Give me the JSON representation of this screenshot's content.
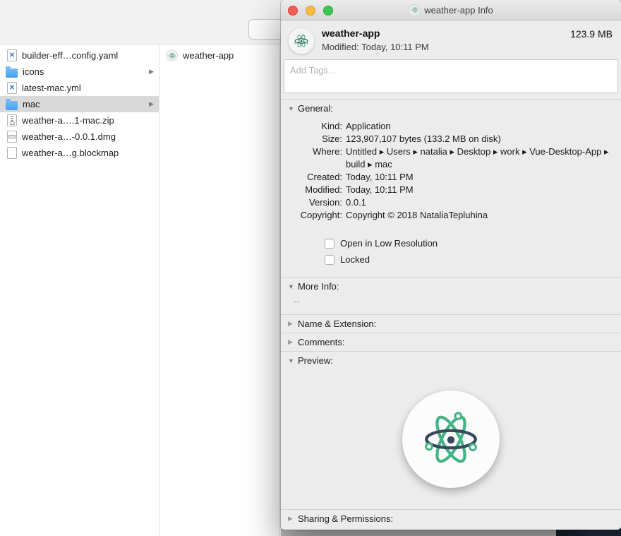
{
  "icons": {
    "disclosure_open": "▼",
    "disclosure_closed": "▶",
    "folder_chevron": "▶"
  },
  "colors": {
    "electron_green": "#45b384",
    "electron_dark": "#36495d",
    "wallpaper_navy": "#1c2734",
    "folder_blue": "#5fb0f5",
    "selection_gray": "#d9d9d9"
  },
  "finder": {
    "column1": {
      "items": [
        {
          "name": "builder-eff…config.yaml",
          "type": "yaml"
        },
        {
          "name": "icons",
          "type": "folder"
        },
        {
          "name": "latest-mac.yml",
          "type": "yaml"
        },
        {
          "name": "mac",
          "type": "folder"
        },
        {
          "name": "weather-a….1-mac.zip",
          "type": "zip"
        },
        {
          "name": "weather-a…-0.0.1.dmg",
          "type": "dmg"
        },
        {
          "name": "weather-a…g.blockmap",
          "type": "doc"
        }
      ]
    },
    "column2": {
      "items": [
        {
          "name": "weather-app",
          "type": "app"
        }
      ]
    }
  },
  "info": {
    "window_title": "weather-app Info",
    "app_name": "weather-app",
    "app_size": "123.9 MB",
    "modified_line": "Modified: Today, 10:11 PM",
    "tags_placeholder": "Add Tags...",
    "general": {
      "label": "General:",
      "rows": [
        {
          "label": "Kind:",
          "value": "Application"
        },
        {
          "label": "Size:",
          "value": "123,907,107 bytes (133.2 MB on disk)"
        },
        {
          "label": "Where:",
          "value": "Untitled ▸ Users ▸ natalia ▸ Desktop ▸ work ▸ Vue-Desktop-App ▸ build ▸ mac"
        },
        {
          "label": "Created:",
          "value": "Today, 10:11 PM"
        },
        {
          "label": "Modified:",
          "value": "Today, 10:11 PM"
        },
        {
          "label": "Version:",
          "value": "0.0.1"
        },
        {
          "label": "Copyright:",
          "value": "Copyright © 2018 NataliaTepluhina"
        }
      ],
      "checkboxes": [
        {
          "label": "Open in Low Resolution"
        },
        {
          "label": "Locked"
        }
      ]
    },
    "more_info": {
      "label": "More Info:",
      "value": "--"
    },
    "name_extension": {
      "label": "Name & Extension:"
    },
    "comments": {
      "label": "Comments:"
    },
    "preview": {
      "label": "Preview:"
    },
    "sharing": {
      "label": "Sharing & Permissions:"
    }
  }
}
